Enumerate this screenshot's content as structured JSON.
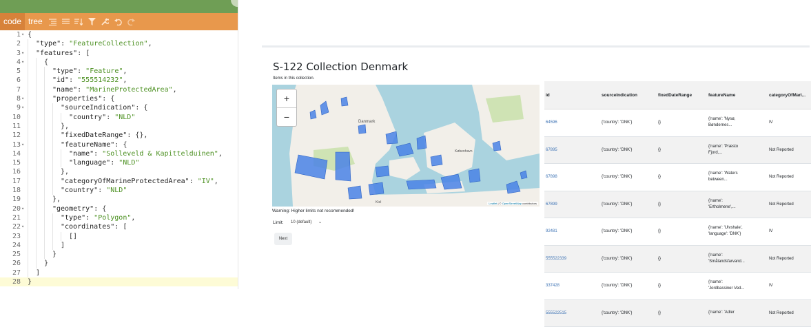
{
  "editor": {
    "toolbar": {
      "modes": [
        "code",
        "tree"
      ],
      "icons": [
        "format-icon",
        "compact-icon",
        "sort-icon",
        "filter-icon",
        "repair-icon",
        "undo-icon",
        "redo-icon"
      ]
    },
    "lines": [
      {
        "n": "1",
        "fold": "▾",
        "depth": 0,
        "tokens": [
          {
            "t": "p",
            "v": "{"
          }
        ]
      },
      {
        "n": "2",
        "fold": "",
        "depth": 1,
        "tokens": [
          {
            "t": "k",
            "v": "\"type\""
          },
          {
            "t": "p",
            "v": ": "
          },
          {
            "t": "s",
            "v": "\"FeatureCollection\""
          },
          {
            "t": "p",
            "v": ","
          }
        ]
      },
      {
        "n": "3",
        "fold": "▾",
        "depth": 1,
        "tokens": [
          {
            "t": "k",
            "v": "\"features\""
          },
          {
            "t": "p",
            "v": ": ["
          }
        ]
      },
      {
        "n": "4",
        "fold": "▾",
        "depth": 2,
        "tokens": [
          {
            "t": "p",
            "v": "{"
          }
        ]
      },
      {
        "n": "5",
        "fold": "",
        "depth": 3,
        "tokens": [
          {
            "t": "k",
            "v": "\"type\""
          },
          {
            "t": "p",
            "v": ": "
          },
          {
            "t": "s",
            "v": "\"Feature\""
          },
          {
            "t": "p",
            "v": ","
          }
        ]
      },
      {
        "n": "6",
        "fold": "",
        "depth": 3,
        "tokens": [
          {
            "t": "k",
            "v": "\"id\""
          },
          {
            "t": "p",
            "v": ": "
          },
          {
            "t": "s",
            "v": "\"555514232\""
          },
          {
            "t": "p",
            "v": ","
          }
        ]
      },
      {
        "n": "7",
        "fold": "",
        "depth": 3,
        "tokens": [
          {
            "t": "k",
            "v": "\"name\""
          },
          {
            "t": "p",
            "v": ": "
          },
          {
            "t": "s",
            "v": "\"MarineProtectedArea\""
          },
          {
            "t": "p",
            "v": ","
          }
        ]
      },
      {
        "n": "8",
        "fold": "▾",
        "depth": 3,
        "tokens": [
          {
            "t": "k",
            "v": "\"properties\""
          },
          {
            "t": "p",
            "v": ": {"
          }
        ]
      },
      {
        "n": "9",
        "fold": "▾",
        "depth": 4,
        "tokens": [
          {
            "t": "k",
            "v": "\"sourceIndication\""
          },
          {
            "t": "p",
            "v": ": {"
          }
        ]
      },
      {
        "n": "10",
        "fold": "",
        "depth": 5,
        "tokens": [
          {
            "t": "k",
            "v": "\"country\""
          },
          {
            "t": "p",
            "v": ": "
          },
          {
            "t": "s",
            "v": "\"NLD\""
          }
        ]
      },
      {
        "n": "11",
        "fold": "",
        "depth": 4,
        "tokens": [
          {
            "t": "p",
            "v": "},"
          }
        ]
      },
      {
        "n": "12",
        "fold": "",
        "depth": 4,
        "tokens": [
          {
            "t": "k",
            "v": "\"fixedDateRange\""
          },
          {
            "t": "p",
            "v": ": {},"
          }
        ]
      },
      {
        "n": "13",
        "fold": "▾",
        "depth": 4,
        "tokens": [
          {
            "t": "k",
            "v": "\"featureName\""
          },
          {
            "t": "p",
            "v": ": {"
          }
        ]
      },
      {
        "n": "14",
        "fold": "",
        "depth": 5,
        "tokens": [
          {
            "t": "k",
            "v": "\"name\""
          },
          {
            "t": "p",
            "v": ": "
          },
          {
            "t": "s",
            "v": "\"Solleveld & Kapittelduinen\""
          },
          {
            "t": "p",
            "v": ","
          }
        ]
      },
      {
        "n": "15",
        "fold": "",
        "depth": 5,
        "tokens": [
          {
            "t": "k",
            "v": "\"language\""
          },
          {
            "t": "p",
            "v": ": "
          },
          {
            "t": "s",
            "v": "\"NLD\""
          }
        ]
      },
      {
        "n": "16",
        "fold": "",
        "depth": 4,
        "tokens": [
          {
            "t": "p",
            "v": "},"
          }
        ]
      },
      {
        "n": "17",
        "fold": "",
        "depth": 4,
        "tokens": [
          {
            "t": "k",
            "v": "\"categoryOfMarineProtectedArea\""
          },
          {
            "t": "p",
            "v": ": "
          },
          {
            "t": "s",
            "v": "\"IV\""
          },
          {
            "t": "p",
            "v": ","
          }
        ]
      },
      {
        "n": "18",
        "fold": "",
        "depth": 4,
        "tokens": [
          {
            "t": "k",
            "v": "\"country\""
          },
          {
            "t": "p",
            "v": ": "
          },
          {
            "t": "s",
            "v": "\"NLD\""
          }
        ]
      },
      {
        "n": "19",
        "fold": "",
        "depth": 3,
        "tokens": [
          {
            "t": "p",
            "v": "},"
          }
        ]
      },
      {
        "n": "20",
        "fold": "▾",
        "depth": 3,
        "tokens": [
          {
            "t": "k",
            "v": "\"geometry\""
          },
          {
            "t": "p",
            "v": ": {"
          }
        ]
      },
      {
        "n": "21",
        "fold": "",
        "depth": 4,
        "tokens": [
          {
            "t": "k",
            "v": "\"type\""
          },
          {
            "t": "p",
            "v": ": "
          },
          {
            "t": "s",
            "v": "\"Polygon\""
          },
          {
            "t": "p",
            "v": ","
          }
        ]
      },
      {
        "n": "22",
        "fold": "▾",
        "depth": 4,
        "tokens": [
          {
            "t": "k",
            "v": "\"coordinates\""
          },
          {
            "t": "p",
            "v": ": ["
          }
        ]
      },
      {
        "n": "23",
        "fold": "",
        "depth": 5,
        "tokens": [
          {
            "t": "p",
            "v": "[]"
          }
        ]
      },
      {
        "n": "24",
        "fold": "",
        "depth": 4,
        "tokens": [
          {
            "t": "p",
            "v": "]"
          }
        ]
      },
      {
        "n": "25",
        "fold": "",
        "depth": 3,
        "tokens": [
          {
            "t": "p",
            "v": "}"
          }
        ]
      },
      {
        "n": "26",
        "fold": "",
        "depth": 2,
        "tokens": [
          {
            "t": "p",
            "v": "}"
          }
        ]
      },
      {
        "n": "27",
        "fold": "",
        "depth": 1,
        "tokens": [
          {
            "t": "p",
            "v": "]"
          }
        ]
      },
      {
        "n": "28",
        "fold": "",
        "depth": 0,
        "tokens": [
          {
            "t": "p",
            "v": "}"
          }
        ],
        "highlight": true
      }
    ]
  },
  "page": {
    "title": "S-122 Collection Denmark",
    "subtitle": "Items in this collection.",
    "map": {
      "zoom_in": "+",
      "zoom_out": "−",
      "attribution_link": "Leaflet",
      "attribution_sep": " | © ",
      "attribution_osm": "OpenStreetMap",
      "attribution_tail": " contributors",
      "labels": [
        "Danmark",
        "København",
        "Kiel"
      ],
      "colors": {
        "water": "#aad3df",
        "land": "#f2efe9",
        "green": "#cfe3b4",
        "protected": "#4a82e6"
      }
    },
    "warning": "Warning: Higher limits not recommended!",
    "limit_label": "Limit:",
    "limit_value": "10 (default)",
    "next_button": "Next",
    "table": {
      "headers": [
        "id",
        "sourceIndication",
        "fixedDateRange",
        "featureName",
        "categoryOfMari..."
      ],
      "rows": [
        {
          "id": "64596",
          "source": "{'country': 'DNK'}",
          "fixed": "{}",
          "name1": "{'name': 'Nysø,",
          "name2": "Bøndernes...",
          "category": "IV"
        },
        {
          "id": "67895",
          "source": "{'country': 'DNK'}",
          "fixed": "{}",
          "name1": "{'name': 'Præsto",
          "name2": "Fjord,...",
          "category": "Not Reported"
        },
        {
          "id": "67898",
          "source": "{'country': 'DNK'}",
          "fixed": "{}",
          "name1": "{'name': 'Waters",
          "name2": "between...",
          "category": "Not Reported"
        },
        {
          "id": "67899",
          "source": "{'country': 'DNK'}",
          "fixed": "{}",
          "name1": "{'name':",
          "name2": "'Ertholmene',...",
          "category": "Not Reported"
        },
        {
          "id": "92481",
          "source": "{'country': 'DNK'}",
          "fixed": "{}",
          "name1": "{'name': 'Ulvshale',",
          "name2": "'language': 'DNK'}",
          "category": "IV"
        },
        {
          "id": "555522339",
          "source": "{'country': 'DNK'}",
          "fixed": "{}",
          "name1": "{'name':",
          "name2": "'Smålandsfarvand...",
          "category": "Not Reported"
        },
        {
          "id": "337428",
          "source": "{'country': 'DNK'}",
          "fixed": "{}",
          "name1": "{'name':",
          "name2": "'Jordbassiner Ved...",
          "category": "IV"
        },
        {
          "id": "555522515",
          "source": "{'country': 'DNK'}",
          "fixed": "{}",
          "name1": "{'name': 'Adler",
          "name2": "",
          "category": "Not Reported"
        }
      ]
    }
  }
}
